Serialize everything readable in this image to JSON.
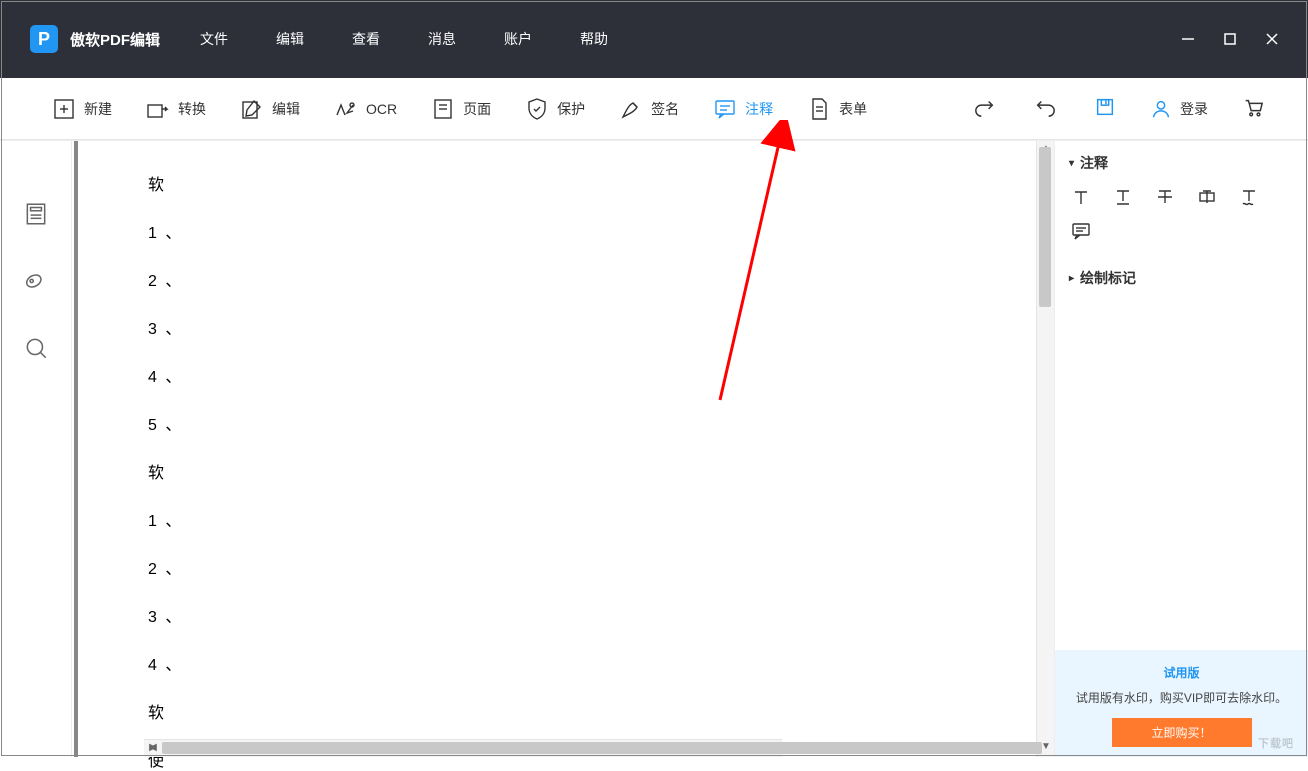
{
  "app": {
    "title": "傲软PDF编辑"
  },
  "menu": [
    "文件",
    "编辑",
    "查看",
    "消息",
    "账户",
    "帮助"
  ],
  "toolbar": {
    "new": "新建",
    "convert": "转换",
    "edit": "编辑",
    "ocr": "OCR",
    "page": "页面",
    "protect": "保护",
    "sign": "签名",
    "annotate": "注释",
    "form": "表单",
    "login": "登录"
  },
  "document": {
    "lines": [
      "软",
      "1 、",
      "2 、",
      "3 、",
      "4 、",
      "5 、",
      "软",
      "1 、",
      "2 、",
      "3 、",
      "4 、",
      "软",
      "使"
    ]
  },
  "rightPanel": {
    "annotation_header": "注释",
    "draw_header": "绘制标记"
  },
  "trial": {
    "title": "试用版",
    "text": "试用版有水印，购买VIP即可去除水印。",
    "buy": "立即购买！"
  },
  "watermark": "下载吧"
}
